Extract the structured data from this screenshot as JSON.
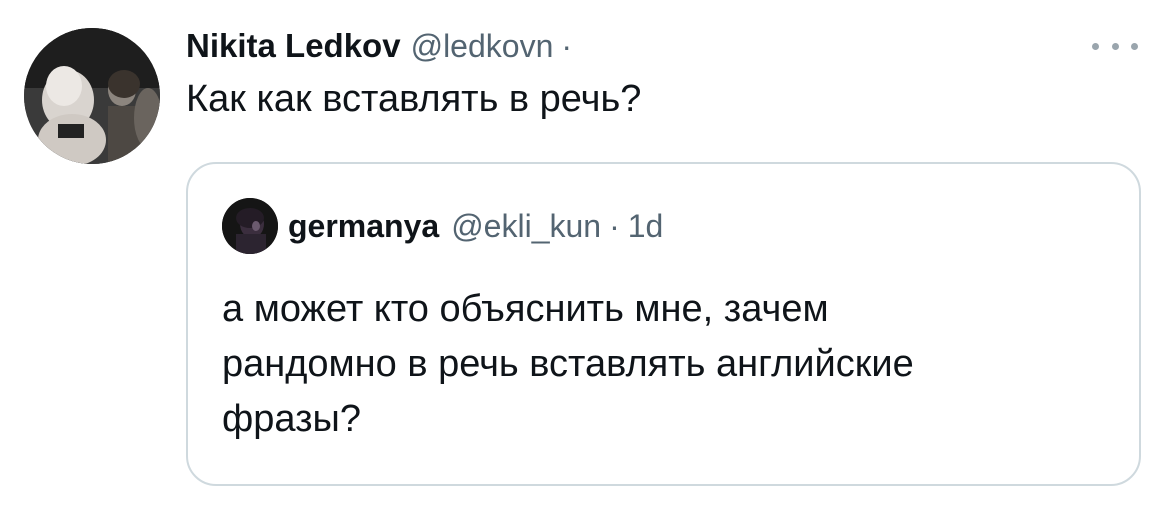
{
  "tweet": {
    "author_name": "Nikita Ledkov",
    "author_handle": "@ledkovn",
    "separator": "·",
    "text": "Как как вставлять в речь?",
    "more_icon": "more-horizontal-icon"
  },
  "quoted_tweet": {
    "author_name": "germanya",
    "author_handle": "@ekli_kun",
    "separator": "·",
    "time": "1d",
    "text_lines": [
      "а может кто объяснить мне, зачем",
      "рандомно в речь вставлять английские",
      "фразы?"
    ]
  },
  "colors": {
    "primary_text": "#0f1419",
    "secondary_text": "#536471",
    "border": "#cfd9de"
  }
}
